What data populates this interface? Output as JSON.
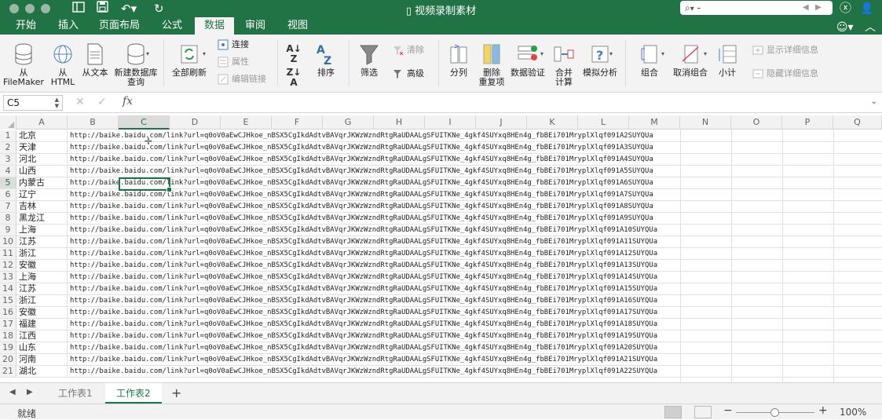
{
  "titlebar": {
    "doc_title": "视频录制素材",
    "search_value": "-",
    "icons": [
      "sidebar-icon",
      "save-icon",
      "undo-icon",
      "redo-icon",
      "search-icon",
      "add-person-icon"
    ]
  },
  "ribbon_tabs": [
    "开始",
    "插入",
    "页面布局",
    "公式",
    "数据",
    "审阅",
    "视图"
  ],
  "active_tab": "数据",
  "ribbon": {
    "from_filemaker": "从\nFileMaker",
    "from_html": "从\nHTML",
    "from_text": "从文本",
    "new_db_query": "新建数据库\n查询",
    "refresh_all": "全部刷新",
    "connections": "连接",
    "properties": "属性",
    "edit_links": "编辑链接",
    "sort": "排序",
    "filter": "筛选",
    "clear": "清除",
    "advanced": "高级",
    "text_to_columns": "分列",
    "remove_duplicates": "删除\n重复项",
    "data_validation": "数据验证",
    "consolidate": "合并\n计算",
    "what_if": "模拟分析",
    "group": "组合",
    "ungroup": "取消组合",
    "subtotal": "小计",
    "show_detail": "显示详细信息",
    "hide_detail": "隐藏详细信息"
  },
  "formula_bar": {
    "name_box": "C5",
    "fx": "fx",
    "formula": ""
  },
  "columns": [
    "A",
    "B",
    "C",
    "D",
    "E",
    "F",
    "G",
    "H",
    "I",
    "J",
    "K",
    "L",
    "M",
    "N",
    "O",
    "P",
    "Q"
  ],
  "selected_cell": "C5",
  "rows": [
    {
      "n": "1",
      "a": "北京",
      "b": "http://baike.baidu.com/link?url=q0oV0aEwCJHkoe_nBSX5CgIkdAdtvBAVqrJKWzWzndRtgRaUDAALgSFUITKNe_4gkf4SUYxq8HEn4g_fbBEi701MryplXlqf091A2SUYQUa"
    },
    {
      "n": "2",
      "a": "天津",
      "b": "http://baike.baidu.com/link?url=q0oV0aEwCJHkoe_nBSX5CgIkdAdtvBAVqrJKWzWzndRtgRaUDAALgSFUITKNe_4gkf4SUYxq8HEn4g_fbBEi701MryplXlqf091A3SUYQUa"
    },
    {
      "n": "3",
      "a": "河北",
      "b": "http://baike.baidu.com/link?url=q0oV0aEwCJHkoe_nBSX5CgIkdAdtvBAVqrJKWzWzndRtgRaUDAALgSFUITKNe_4gkf4SUYxq8HEn4g_fbBEi701MryplXlqf091A4SUYQUa"
    },
    {
      "n": "4",
      "a": "山西",
      "b": "http://baike.baidu.com/link?url=q0oV0aEwCJHkoe_nBSX5CgIkdAdtvBAVqrJKWzWzndRtgRaUDAALgSFUITKNe_4gkf4SUYxq8HEn4g_fbBEi701MryplXlqf091A5SUYQUa"
    },
    {
      "n": "5",
      "a": "内蒙古",
      "b": "http://baike.baidu.com/link?url=q0oV0aEwCJHkoe_nBSX5CgIkdAdtvBAVqrJKWzWzndRtgRaUDAALgSFUITKNe_4gkf4SUYxq8HEn4g_fbBEi701MryplXlqf091A6SUYQUa"
    },
    {
      "n": "6",
      "a": "辽宁",
      "b": "http://baike.baidu.com/link?url=q0oV0aEwCJHkoe_nBSX5CgIkdAdtvBAVqrJKWzWzndRtgRaUDAALgSFUITKNe_4gkf4SUYxq8HEn4g_fbBEi701MryplXlqf091A7SUYQUa"
    },
    {
      "n": "7",
      "a": "吉林",
      "b": "http://baike.baidu.com/link?url=q0oV0aEwCJHkoe_nBSX5CgIkdAdtvBAVqrJKWzWzndRtgRaUDAALgSFUITKNe_4gkf4SUYxq8HEn4g_fbBEi701MryplXlqf091A8SUYQUa"
    },
    {
      "n": "8",
      "a": "黑龙江",
      "b": "http://baike.baidu.com/link?url=q0oV0aEwCJHkoe_nBSX5CgIkdAdtvBAVqrJKWzWzndRtgRaUDAALgSFUITKNe_4gkf4SUYxq8HEn4g_fbBEi701MryplXlqf091A9SUYQUa"
    },
    {
      "n": "9",
      "a": "上海",
      "b": "http://baike.baidu.com/link?url=q0oV0aEwCJHkoe_nBSX5CgIkdAdtvBAVqrJKWzWzndRtgRaUDAALgSFUITKNe_4gkf4SUYxq8HEn4g_fbBEi701MryplXlqf091A10SUYQUa"
    },
    {
      "n": "10",
      "a": "江苏",
      "b": "http://baike.baidu.com/link?url=q0oV0aEwCJHkoe_nBSX5CgIkdAdtvBAVqrJKWzWzndRtgRaUDAALgSFUITKNe_4gkf4SUYxq8HEn4g_fbBEi701MryplXlqf091A11SUYQUa"
    },
    {
      "n": "11",
      "a": "浙江",
      "b": "http://baike.baidu.com/link?url=q0oV0aEwCJHkoe_nBSX5CgIkdAdtvBAVqrJKWzWzndRtgRaUDAALgSFUITKNe_4gkf4SUYxq8HEn4g_fbBEi701MryplXlqf091A12SUYQUa"
    },
    {
      "n": "12",
      "a": "安徽",
      "b": "http://baike.baidu.com/link?url=q0oV0aEwCJHkoe_nBSX5CgIkdAdtvBAVqrJKWzWzndRtgRaUDAALgSFUITKNe_4gkf4SUYxq8HEn4g_fbBEi701MryplXlqf091A13SUYQUa"
    },
    {
      "n": "13",
      "a": "上海",
      "b": "http://baike.baidu.com/link?url=q0oV0aEwCJHkoe_nBSX5CgIkdAdtvBAVqrJKWzWzndRtgRaUDAALgSFUITKNe_4gkf4SUYxq8HEn4g_fbBEi701MryplXlqf091A14SUYQUa"
    },
    {
      "n": "14",
      "a": "江苏",
      "b": "http://baike.baidu.com/link?url=q0oV0aEwCJHkoe_nBSX5CgIkdAdtvBAVqrJKWzWzndRtgRaUDAALgSFUITKNe_4gkf4SUYxq8HEn4g_fbBEi701MryplXlqf091A15SUYQUa"
    },
    {
      "n": "15",
      "a": "浙江",
      "b": "http://baike.baidu.com/link?url=q0oV0aEwCJHkoe_nBSX5CgIkdAdtvBAVqrJKWzWzndRtgRaUDAALgSFUITKNe_4gkf4SUYxq8HEn4g_fbBEi701MryplXlqf091A16SUYQUa"
    },
    {
      "n": "16",
      "a": "安徽",
      "b": "http://baike.baidu.com/link?url=q0oV0aEwCJHkoe_nBSX5CgIkdAdtvBAVqrJKWzWzndRtgRaUDAALgSFUITKNe_4gkf4SUYxq8HEn4g_fbBEi701MryplXlqf091A17SUYQUa"
    },
    {
      "n": "17",
      "a": "福建",
      "b": "http://baike.baidu.com/link?url=q0oV0aEwCJHkoe_nBSX5CgIkdAdtvBAVqrJKWzWzndRtgRaUDAALgSFUITKNe_4gkf4SUYxq8HEn4g_fbBEi701MryplXlqf091A18SUYQUa"
    },
    {
      "n": "18",
      "a": "江西",
      "b": "http://baike.baidu.com/link?url=q0oV0aEwCJHkoe_nBSX5CgIkdAdtvBAVqrJKWzWzndRtgRaUDAALgSFUITKNe_4gkf4SUYxq8HEn4g_fbBEi701MryplXlqf091A19SUYQUa"
    },
    {
      "n": "19",
      "a": "山东",
      "b": "http://baike.baidu.com/link?url=q0oV0aEwCJHkoe_nBSX5CgIkdAdtvBAVqrJKWzWzndRtgRaUDAALgSFUITKNe_4gkf4SUYxq8HEn4g_fbBEi701MryplXlqf091A20SUYQUa"
    },
    {
      "n": "20",
      "a": "河南",
      "b": "http://baike.baidu.com/link?url=q0oV0aEwCJHkoe_nBSX5CgIkdAdtvBAVqrJKWzWzndRtgRaUDAALgSFUITKNe_4gkf4SUYxq8HEn4g_fbBEi701MryplXlqf091A21SUYQUa"
    },
    {
      "n": "21",
      "a": "湖北",
      "b": "http://baike.baidu.com/link?url=q0oV0aEwCJHkoe_nBSX5CgIkdAdtvBAVqrJKWzWzndRtgRaUDAALgSFUITKNe_4gkf4SUYxq8HEn4g_fbBEi701MryplXlqf091A22SUYQUa"
    }
  ],
  "sheets": [
    "工作表1",
    "工作表2"
  ],
  "active_sheet": "工作表2",
  "status": "就绪",
  "zoom": "100%",
  "colors": {
    "accent": "#217346",
    "ribbon_bg": "#f3f3f3"
  }
}
